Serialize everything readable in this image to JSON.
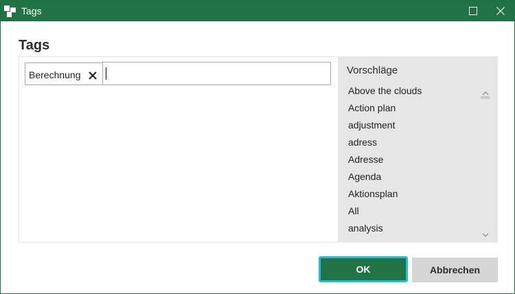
{
  "window": {
    "title": "Tags",
    "colors": {
      "titlebar": "#217346",
      "accent_focus": "#1fbfd6"
    }
  },
  "main": {
    "heading": "Tags",
    "tags": [
      {
        "label": "Berechnung"
      }
    ],
    "tag_input": {
      "value": "",
      "placeholder": ""
    }
  },
  "suggestions": {
    "title": "Vorschläge",
    "items": [
      "Above the clouds",
      "Action plan",
      "adjustment",
      "adress",
      "Adresse",
      "Agenda",
      "Aktionsplan",
      "All",
      "analysis"
    ]
  },
  "footer": {
    "ok_label": "OK",
    "cancel_label": "Abbrechen"
  }
}
